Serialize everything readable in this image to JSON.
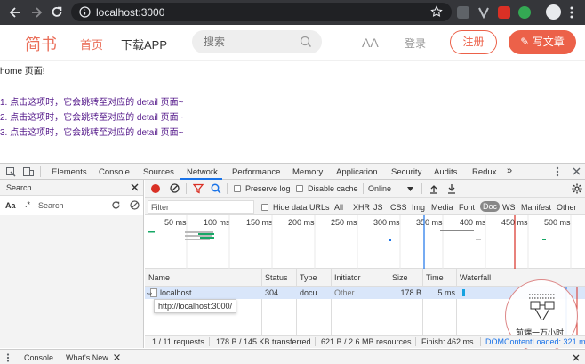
{
  "browser": {
    "url": "localhost:3000"
  },
  "site": {
    "logo": "简书",
    "nav_home": "首页",
    "nav_download": "下载APP",
    "search_placeholder": "搜索",
    "font_toggle": "AA",
    "login": "登录",
    "register": "注册",
    "write": "写文章"
  },
  "page": {
    "heading": "home 页面!",
    "items": [
      "1. 点击这项时，它会跳转至对应的 detail 页面~",
      "2. 点击这项时，它会跳转至对应的 detail 页面~",
      "3. 点击这项时，它会跳转至对应的 detail 页面~"
    ]
  },
  "devtools": {
    "tabs": [
      "Elements",
      "Console",
      "Sources",
      "Network",
      "Performance",
      "Memory",
      "Application",
      "Security",
      "Audits",
      "Redux"
    ],
    "active_tab": "Network",
    "search_pane": {
      "title": "Search",
      "case_label": "Aa",
      "regex_label": ".*",
      "input_placeholder": "Search"
    },
    "toolbar": {
      "preserve_log": "Preserve log",
      "disable_cache": "Disable cache",
      "throttling": "Online"
    },
    "filter": {
      "placeholder": "Filter",
      "hide_data_urls": "Hide data URLs",
      "types": [
        "All",
        "XHR",
        "JS",
        "CSS",
        "Img",
        "Media",
        "Font",
        "Doc",
        "WS",
        "Manifest",
        "Other"
      ],
      "active_type": "Doc"
    },
    "timeline_ticks": [
      "50 ms",
      "100 ms",
      "150 ms",
      "200 ms",
      "250 ms",
      "300 ms",
      "350 ms",
      "400 ms",
      "450 ms",
      "500 ms"
    ],
    "columns": [
      "Name",
      "Status",
      "Type",
      "Initiator",
      "Size",
      "Time",
      "Waterfall"
    ],
    "rows": [
      {
        "name": "localhost",
        "status": "304",
        "type": "docu...",
        "initiator": "Other",
        "size": "178 B",
        "time": "5 ms"
      }
    ],
    "tooltip": "http://localhost:3000/",
    "status_bar": {
      "requests": "1 / 11 requests",
      "transferred": "178 B / 145 KB transferred",
      "resources": "621 B / 2.6 MB resources",
      "finish": "Finish: 462 ms",
      "domcontent": "DOMContentLoaded: 321 ms"
    },
    "drawer_tabs": [
      "Console",
      "What's New"
    ],
    "watermark_text": "前端一万小时"
  },
  "colors": {
    "brand": "#ea6f5a",
    "accent_blue": "#1a73e8",
    "record_red": "#d93025"
  }
}
